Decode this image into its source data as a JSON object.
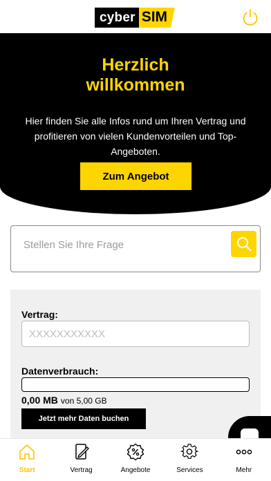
{
  "header": {
    "logo_left": "cyber",
    "logo_right": "SIM"
  },
  "hero": {
    "title": "Herzlich willkommen",
    "text": "Hier finden Sie alle Infos rund um Ihren Vertrag und profitieren von vielen Kundenvorteilen und Top-Angeboten.",
    "cta_label": "Zum Angebot"
  },
  "search": {
    "placeholder": "Stellen Sie Ihre Frage"
  },
  "contract": {
    "vertrag_label": "Vertrag:",
    "vertrag_value": "XXXXXXXXXXX",
    "daten_label": "Datenverbrauch:",
    "used": "0,00 MB",
    "total": "von 5,00 GB",
    "used_fraction": 0.0,
    "buy_label": "Jetzt mehr Daten buchen"
  },
  "tabs": [
    {
      "label": "Start",
      "icon": "home-icon",
      "active": true
    },
    {
      "label": "Vertrag",
      "icon": "contract-icon",
      "active": false
    },
    {
      "label": "Angebote",
      "icon": "percent-badge-icon",
      "active": false
    },
    {
      "label": "Services",
      "icon": "gear-icon",
      "active": false
    },
    {
      "label": "Mehr",
      "icon": "more-dots-icon",
      "active": false
    }
  ],
  "colors": {
    "accent": "#ffd500",
    "dark": "#000000",
    "card_bg": "#f0f0f0"
  }
}
